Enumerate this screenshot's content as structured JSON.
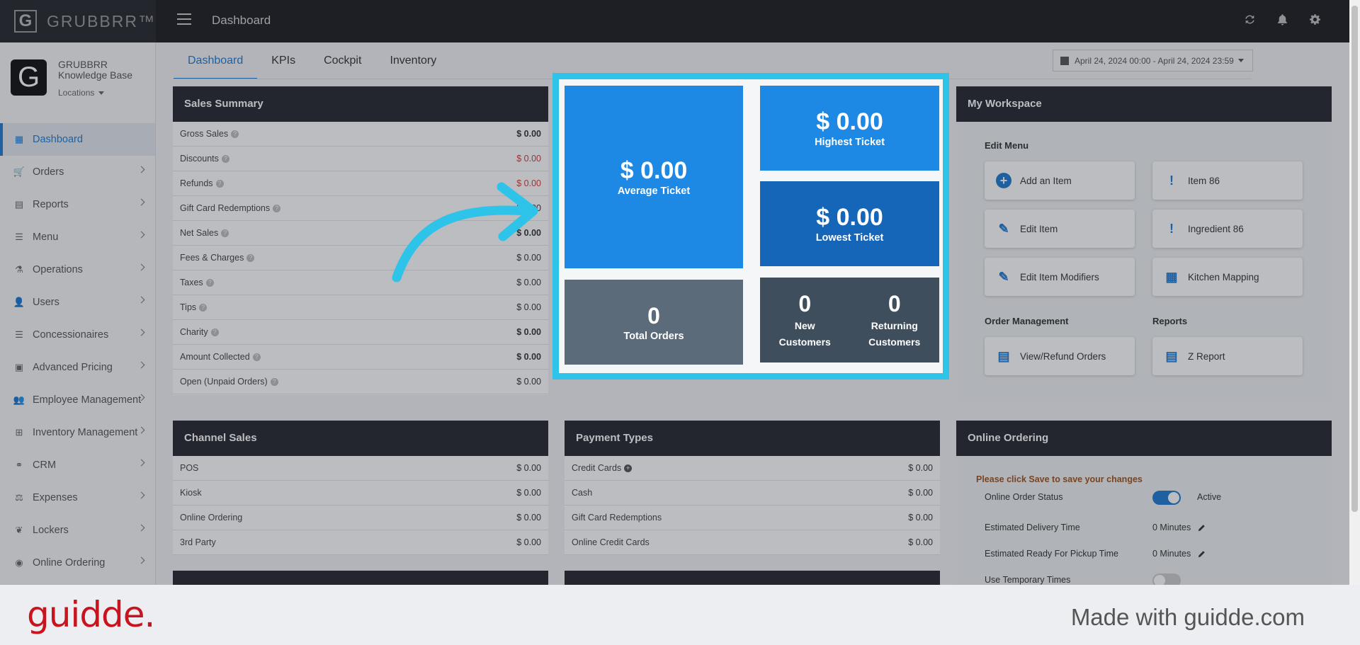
{
  "topbar": {
    "brand": "GRUBBRR™",
    "brand_mark": "G",
    "title": "Dashboard",
    "icons": [
      "refresh-icon",
      "bell-icon",
      "gear-icon"
    ]
  },
  "profile": {
    "avatar_letter": "G",
    "name_line1": "GRUBBRR",
    "name_line2": "Knowledge Base",
    "locations": "Locations"
  },
  "nav": [
    {
      "label": "Dashboard",
      "icon": "dashboard-icon",
      "glyph": "▦",
      "active": true
    },
    {
      "label": "Orders",
      "icon": "cart-icon",
      "glyph": "🛒"
    },
    {
      "label": "Reports",
      "icon": "file-icon",
      "glyph": "▤"
    },
    {
      "label": "Menu",
      "icon": "list-icon",
      "glyph": "☰"
    },
    {
      "label": "Operations",
      "icon": "flask-icon",
      "glyph": "⚗"
    },
    {
      "label": "Users",
      "icon": "user-plus-icon",
      "glyph": "👤"
    },
    {
      "label": "Concessionaires",
      "icon": "list-icon",
      "glyph": "☰"
    },
    {
      "label": "Advanced Pricing",
      "icon": "money-icon",
      "glyph": "▣"
    },
    {
      "label": "Employee Management",
      "icon": "users-icon",
      "glyph": "👥"
    },
    {
      "label": "Inventory Management",
      "icon": "sitemap-icon",
      "glyph": "⊞"
    },
    {
      "label": "CRM",
      "icon": "link-icon",
      "glyph": "⚭"
    },
    {
      "label": "Expenses",
      "icon": "scale-icon",
      "glyph": "⚖"
    },
    {
      "label": "Lockers",
      "icon": "leaf-icon",
      "glyph": "❦"
    },
    {
      "label": "Online Ordering",
      "icon": "globe-icon",
      "glyph": "◉"
    }
  ],
  "tabs": [
    "Dashboard",
    "KPIs",
    "Cockpit",
    "Inventory"
  ],
  "daterange": "April 24, 2024 00:00 - April 24, 2024 23:59",
  "sales_summary": {
    "title": "Sales Summary",
    "rows": [
      {
        "label": "Gross Sales",
        "value": "$ 0.00",
        "style": "bold"
      },
      {
        "label": "Discounts",
        "value": "$ 0.00",
        "style": "neg"
      },
      {
        "label": "Refunds",
        "value": "$ 0.00",
        "style": "neg"
      },
      {
        "label": "Gift Card Redemptions",
        "value": "$ 0.00",
        "style": ""
      },
      {
        "label": "Net Sales",
        "value": "$ 0.00",
        "style": "bold"
      },
      {
        "label": "Fees & Charges",
        "value": "$ 0.00",
        "style": ""
      },
      {
        "label": "Taxes",
        "value": "$ 0.00",
        "style": ""
      },
      {
        "label": "Tips",
        "value": "$ 0.00",
        "style": ""
      },
      {
        "label": "Charity",
        "value": "$ 0.00",
        "style": "bold"
      },
      {
        "label": "Amount Collected",
        "value": "$ 0.00",
        "style": "bold"
      },
      {
        "label": "Open (Unpaid Orders)",
        "value": "$ 0.00",
        "style": ""
      }
    ]
  },
  "kpi": {
    "average": {
      "value": "$ 0.00",
      "label": "Average Ticket"
    },
    "highest": {
      "value": "$ 0.00",
      "label": "Highest Ticket"
    },
    "lowest": {
      "value": "$ 0.00",
      "label": "Lowest Ticket"
    },
    "orders": {
      "value": "0",
      "label": "Total Orders"
    },
    "new_customers": {
      "value": "0",
      "label1": "New",
      "label2": "Customers"
    },
    "returning_customers": {
      "value": "0",
      "label1": "Returning",
      "label2": "Customers"
    }
  },
  "workspace": {
    "title": "My Workspace",
    "edit_menu": "Edit Menu",
    "order_management": "Order Management",
    "reports": "Reports",
    "buttons": {
      "add_item": "Add an Item",
      "item86": "Item 86",
      "edit_item": "Edit Item",
      "ingredient86": "Ingredient 86",
      "edit_modifiers": "Edit Item Modifiers",
      "kitchen_mapping": "Kitchen Mapping",
      "view_refund": "View/Refund Orders",
      "z_report": "Z Report"
    }
  },
  "channel_sales": {
    "title": "Channel Sales",
    "rows": [
      {
        "label": "POS",
        "value": "$ 0.00"
      },
      {
        "label": "Kiosk",
        "value": "$ 0.00"
      },
      {
        "label": "Online Ordering",
        "value": "$ 0.00"
      },
      {
        "label": "3rd Party",
        "value": "$ 0.00"
      }
    ]
  },
  "payment_types": {
    "title": "Payment Types",
    "rows": [
      {
        "label": "Credit Cards",
        "value": "$ 0.00"
      },
      {
        "label": "Cash",
        "value": "$ 0.00"
      },
      {
        "label": "Gift Card Redemptions",
        "value": "$ 0.00"
      },
      {
        "label": "Online Credit Cards",
        "value": "$ 0.00"
      }
    ]
  },
  "online_ordering": {
    "title": "Online Ordering",
    "note": "Please click Save to save your changes",
    "status_label": "Online Order Status",
    "status_value": "Active",
    "delivery_label": "Estimated Delivery Time",
    "delivery_value": "0 Minutes",
    "pickup_label": "Estimated Ready For Pickup Time",
    "pickup_value": "0 Minutes",
    "temp_label": "Use Temporary Times"
  },
  "footer": {
    "logo": "guidde.",
    "made_with": "Made with guidde.com"
  },
  "colors": {
    "accent": "#1f7ad1",
    "highlight": "#2ec4ea",
    "tile_blue": "#1e88e5",
    "tile_blue_dark": "#1565b8",
    "tile_slate": "#5b6b7a",
    "tile_slate_dark": "#3f4e5c",
    "brand_red": "#c8141f"
  }
}
